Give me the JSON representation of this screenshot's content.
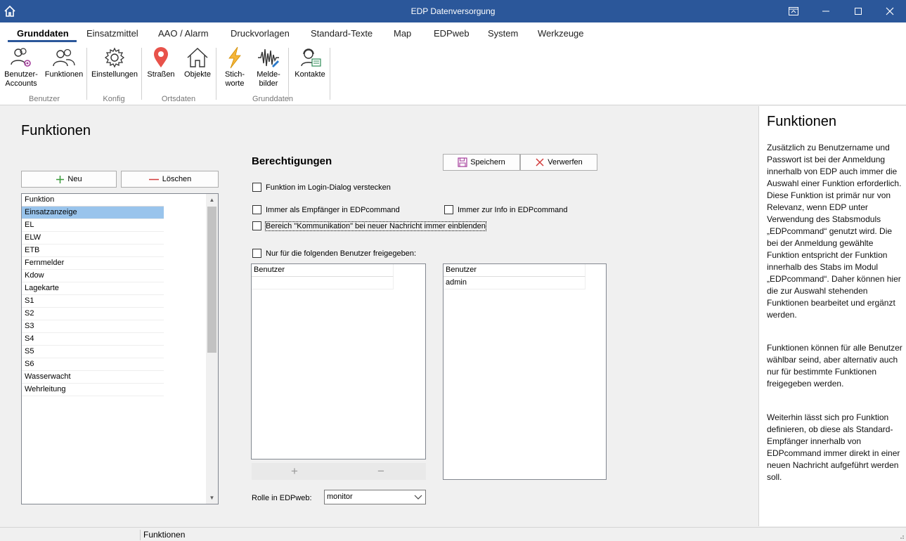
{
  "window": {
    "title": "EDP Datenversorgung"
  },
  "menu": {
    "tabs": [
      {
        "label": "Grunddaten",
        "active": true
      },
      {
        "label": "Einsatzmittel"
      },
      {
        "label": "AAO / Alarm"
      },
      {
        "label": "Druckvorlagen"
      },
      {
        "label": "Standard-Texte"
      },
      {
        "label": "Map"
      },
      {
        "label": "EDPweb"
      },
      {
        "label": "System"
      },
      {
        "label": "Werkzeuge"
      }
    ]
  },
  "ribbon": {
    "buttons": [
      {
        "line1": "Benutzer-",
        "line2": "Accounts",
        "icon": "users-gear-icon"
      },
      {
        "line1": "Funktionen",
        "line2": "",
        "icon": "users-icon"
      },
      {
        "line1": "Einstellungen",
        "line2": "",
        "icon": "gear-icon"
      },
      {
        "line1": "Straßen",
        "line2": "",
        "icon": "map-pin-icon"
      },
      {
        "line1": "Objekte",
        "line2": "",
        "icon": "house-icon"
      },
      {
        "line1": "Stich-",
        "line2": "worte",
        "icon": "lightning-icon"
      },
      {
        "line1": "Melde-",
        "line2": "bilder",
        "icon": "waveform-icon"
      },
      {
        "line1": "Kontakte",
        "line2": "",
        "icon": "headset-contact-icon"
      }
    ],
    "groups": [
      "Benutzer",
      "Konfig",
      "Ortsdaten",
      "Grunddaten"
    ]
  },
  "main": {
    "title": "Funktionen",
    "new_label": "Neu",
    "delete_label": "Löschen",
    "list": {
      "header": "Funktion",
      "items": [
        "Einsatzanzeige",
        "EL",
        "ELW",
        "ETB",
        "Fernmelder",
        "Kdow",
        "Lagekarte",
        "S1",
        "S2",
        "S3",
        "S4",
        "S5",
        "S6",
        "Wasserwacht",
        "Wehrleitung"
      ],
      "selected_index": 0
    },
    "permissions": {
      "title": "Berechtigungen",
      "save_label": "Speichern",
      "discard_label": "Verwerfen",
      "chk_hide_login": "Funktion im Login-Dialog verstecken",
      "chk_always_recipient": "Immer als Empfänger in EDPcommand",
      "chk_always_info": "Immer zur Info in EDPcommand",
      "chk_communication": "Bereich \"Kommunikation\" bei neuer Nachricht immer einblenden",
      "chk_only_users": "Nur für die folgenden Benutzer freigegeben:",
      "left_grid": {
        "header": "Benutzer",
        "rows": [
          ""
        ]
      },
      "right_grid": {
        "header": "Benutzer",
        "rows": [
          "admin"
        ]
      },
      "add_symbol": "+",
      "remove_symbol": "−",
      "role_label": "Rolle in EDPweb:",
      "role_value": "monitor"
    }
  },
  "side": {
    "title": "Funktionen",
    "para1": "Zusätzlich zu Benutzername und Passwort ist bei der Anmeldung innerhalb von EDP auch immer die Auswahl einer Funktion erforderlich. Diese Funktion ist primär nur von Relevanz, wenn EDP unter Verwendung des Stabsmoduls „EDPcommand“ genutzt wird. Die bei der Anmeldung gewählte Funktion entspricht der Funktion innerhalb des Stabs im Modul „EDPcommand“. Daher können hier die zur Auswahl stehenden Funktionen bearbeitet und ergänzt werden.",
    "para2": "Funktionen können für alle Benutzer wählbar seind, aber alternativ auch nur für bestimmte Funktionen freigegeben werden.",
    "para3": "Weiterhin lässt sich pro Funktion definieren, ob diese als Standard-Empfänger innerhalb von EDPcommand immer direkt in einer neuen Nachricht aufgeführt werden soll."
  },
  "status": {
    "text": "Funktionen"
  },
  "colors": {
    "titlebar": "#2b579a",
    "selection": "#99c4ec"
  }
}
